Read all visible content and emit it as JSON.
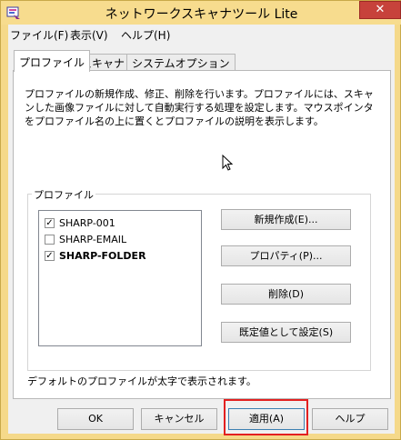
{
  "window": {
    "title": "ネットワークスキャナツール Lite",
    "close_symbol": "✕",
    "app_icon": "network-scanner-app-icon",
    "frame_color": "#f7dc8e",
    "close_color": "#c7423b"
  },
  "menu": {
    "items": [
      "ファイル(F)",
      "表示(V)",
      "ヘルプ(H)"
    ]
  },
  "tabs": {
    "items": [
      "プロファイル",
      "スキャナ",
      "システムオプション"
    ],
    "active": "プロファイル"
  },
  "profile_tab": {
    "description": "プロファイルの新規作成、修正、削除を行います。プロファイルには、スキャンした画像ファイルに対して自動実行する処理を設定します。マウスポインタをプロファイル名の上に置くとプロファイルの説明を表示します。",
    "group_label": "プロファイル",
    "profiles": [
      {
        "name": "SHARP-001",
        "checked": true,
        "default": false,
        "check_mark": "✓"
      },
      {
        "name": "SHARP-EMAIL",
        "checked": false,
        "default": false,
        "check_mark": ""
      },
      {
        "name": "SHARP-FOLDER",
        "checked": true,
        "default": true,
        "check_mark": "✓"
      }
    ],
    "buttons": {
      "new": "新規作成(E)...",
      "properties": "プロパティ(P)...",
      "delete": "削除(D)",
      "set_default": "既定値として設定(S)"
    },
    "footnote": "デフォルトのプロファイルが太字で表示されます。"
  },
  "dialog_buttons": {
    "ok": "OK",
    "cancel": "キャンセル",
    "apply": "適用(A)",
    "help": "ヘルプ"
  },
  "highlight_color": "#e32020"
}
